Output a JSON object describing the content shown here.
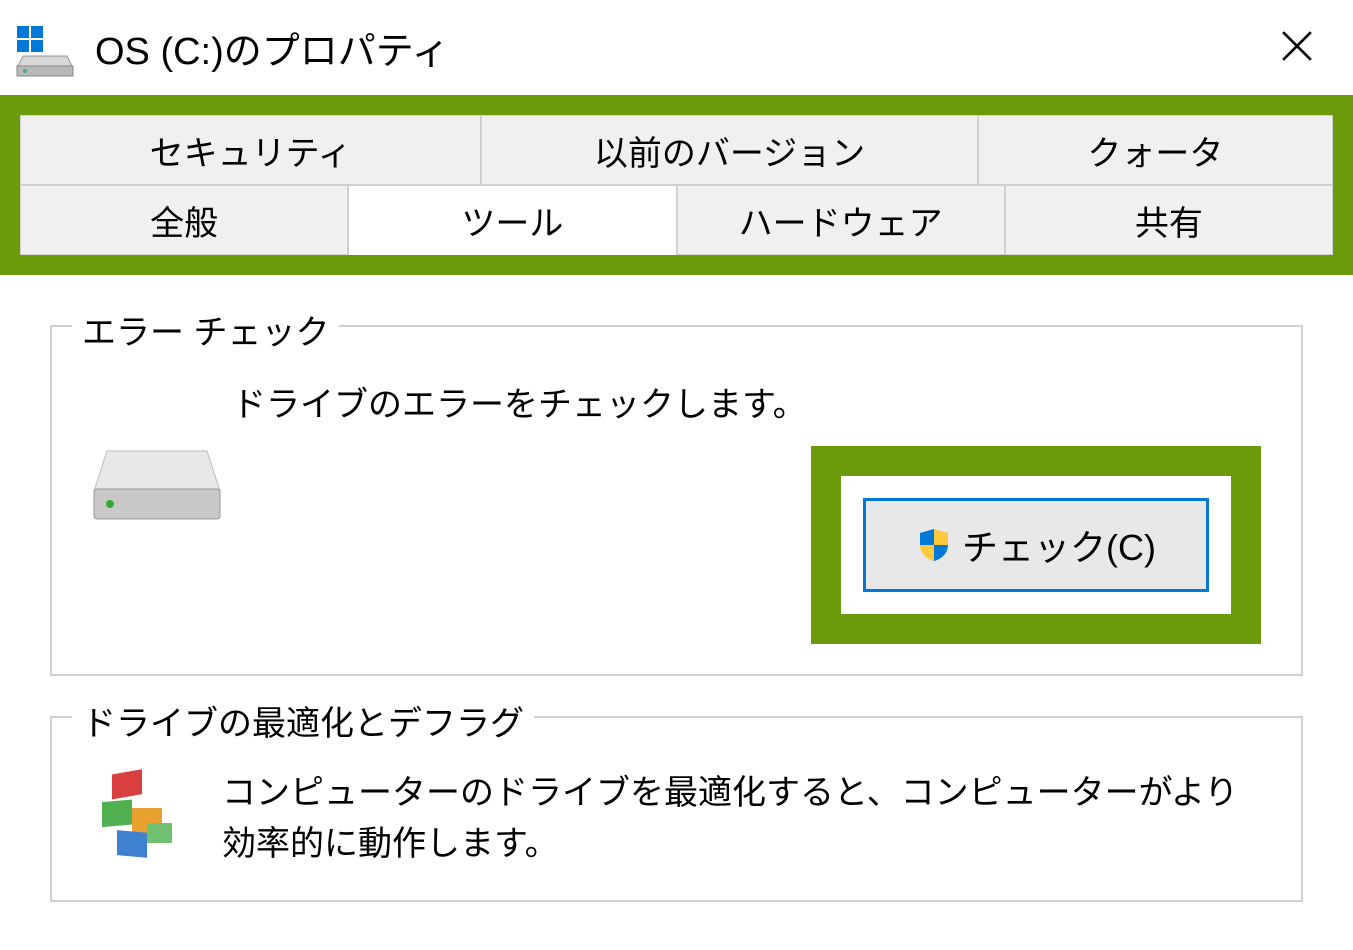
{
  "window": {
    "title": "OS (C:)のプロパティ"
  },
  "tabs": {
    "row1": [
      {
        "label": "セキュリティ",
        "active": false
      },
      {
        "label": "以前のバージョン",
        "active": false
      },
      {
        "label": "クォータ",
        "active": false
      }
    ],
    "row2": [
      {
        "label": "全般",
        "active": false
      },
      {
        "label": "ツール",
        "active": true
      },
      {
        "label": "ハードウェア",
        "active": false
      },
      {
        "label": "共有",
        "active": false
      }
    ]
  },
  "errorCheck": {
    "groupTitle": "エラー チェック",
    "description": "ドライブのエラーをチェックします。",
    "buttonLabel": "チェック(C)"
  },
  "defrag": {
    "groupTitle": "ドライブの最適化とデフラグ",
    "description": "コンピューターのドライブを最適化すると、コンピューターがより効率的に動作します。"
  },
  "highlightColor": "#6b9a0a",
  "accentColor": "#0078d7"
}
